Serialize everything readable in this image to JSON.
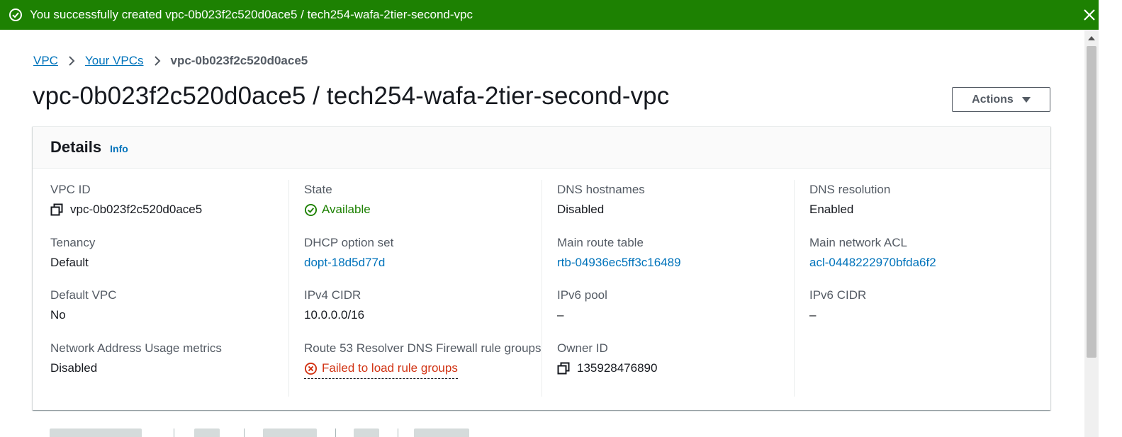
{
  "flash": {
    "message": "You successfully created vpc-0b023f2c520d0ace5 / tech254-wafa-2tier-second-vpc"
  },
  "breadcrumb": {
    "items": [
      "VPC",
      "Your VPCs"
    ],
    "current": "vpc-0b023f2c520d0ace5"
  },
  "page": {
    "title": "vpc-0b023f2c520d0ace5 / tech254-wafa-2tier-second-vpc",
    "actions_label": "Actions"
  },
  "details": {
    "heading": "Details",
    "info_label": "Info",
    "col1": [
      {
        "label": "VPC ID",
        "value": "vpc-0b023f2c520d0ace5"
      },
      {
        "label": "Tenancy",
        "value": "Default"
      },
      {
        "label": "Default VPC",
        "value": "No"
      },
      {
        "label": "Network Address Usage metrics",
        "value": "Disabled"
      }
    ],
    "col2": [
      {
        "label": "State",
        "value": "Available"
      },
      {
        "label": "DHCP option set",
        "value": "dopt-18d5d77d"
      },
      {
        "label": "IPv4 CIDR",
        "value": "10.0.0.0/16"
      },
      {
        "label": "Route 53 Resolver DNS Firewall rule groups",
        "value": "Failed to load rule groups"
      }
    ],
    "col3": [
      {
        "label": "DNS hostnames",
        "value": "Disabled"
      },
      {
        "label": "Main route table",
        "value": "rtb-04936ec5ff3c16489"
      },
      {
        "label": "IPv6 pool",
        "value": "–"
      },
      {
        "label": "Owner ID",
        "value": "135928476890"
      }
    ],
    "col4": [
      {
        "label": "DNS resolution",
        "value": "Enabled"
      },
      {
        "label": "Main network ACL",
        "value": "acl-0448222970bfda6f2"
      },
      {
        "label": "IPv6 CIDR",
        "value": "–"
      }
    ]
  },
  "colors": {
    "success": "#1d8102",
    "link": "#0073bb",
    "error": "#d13212",
    "text": "#16191f",
    "muted": "#545b64"
  },
  "icons": [
    "check-circle-icon",
    "close-icon",
    "chevron-right-icon",
    "caret-down-icon",
    "copy-icon",
    "error-circle-icon"
  ]
}
